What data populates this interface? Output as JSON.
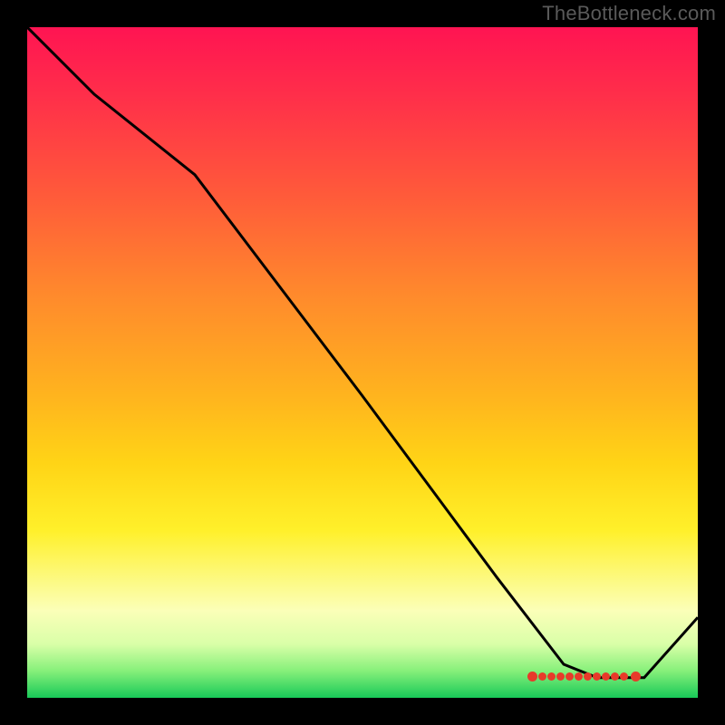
{
  "attribution": "TheBottleneck.com",
  "chart_data": {
    "type": "line",
    "title": "",
    "xlabel": "",
    "ylabel": "",
    "xlim": [
      0,
      100
    ],
    "ylim": [
      0,
      100
    ],
    "series": [
      {
        "name": "bottleneck-curve",
        "x": [
          0,
          10,
          25,
          50,
          70,
          80,
          85,
          90,
          92,
          100
        ],
        "y": [
          100,
          90,
          78,
          45,
          18,
          5,
          3,
          3,
          3,
          12
        ]
      }
    ],
    "markers": {
      "name": "optimal-range",
      "x": [
        80,
        82,
        83,
        84,
        85,
        86,
        87,
        88,
        89,
        90,
        91,
        92
      ],
      "y": [
        3,
        3,
        3,
        3,
        3,
        3,
        3,
        3,
        3,
        3,
        3,
        3
      ]
    },
    "gradient_stops": [
      {
        "pos": 0,
        "color": "#ff1452"
      },
      {
        "pos": 25,
        "color": "#ff5a3a"
      },
      {
        "pos": 55,
        "color": "#ffb41e"
      },
      {
        "pos": 75,
        "color": "#fff02a"
      },
      {
        "pos": 92,
        "color": "#d9ffa8"
      },
      {
        "pos": 100,
        "color": "#18c958"
      }
    ]
  }
}
